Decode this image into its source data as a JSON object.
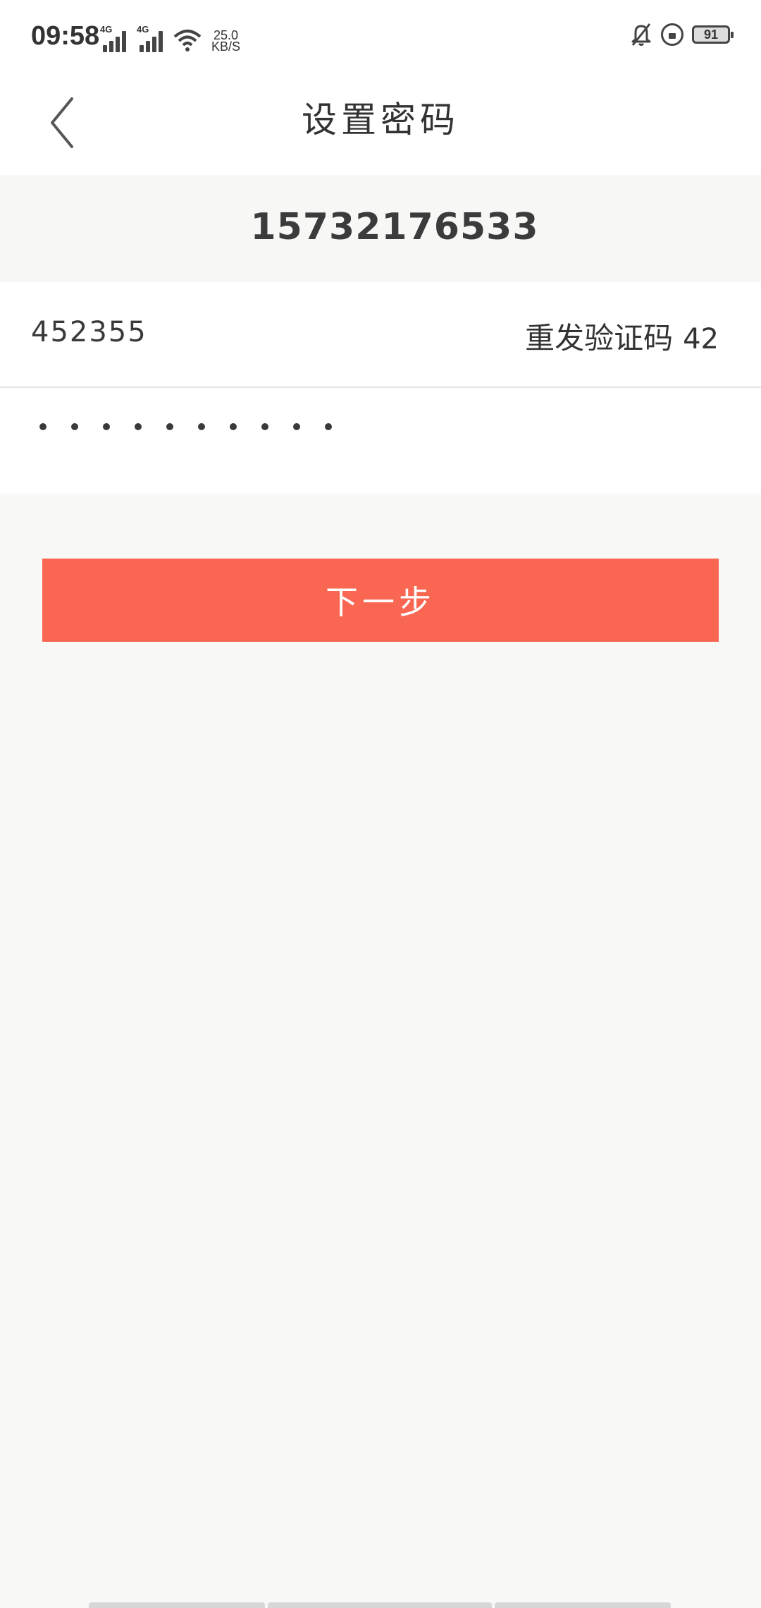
{
  "status_bar": {
    "time": "09:58",
    "network_1": "4G",
    "network_2": "4G",
    "speed_value": "25.0",
    "speed_unit": "KB/S",
    "battery": "91",
    "icons": [
      "signal-icon",
      "signal-icon",
      "wifi-icon",
      "mute-bell-icon",
      "rotation-lock-icon",
      "battery-icon"
    ]
  },
  "header": {
    "title": "设置密码",
    "back_icon": "back-chevron-icon"
  },
  "form": {
    "phone": "15732176533",
    "code_value": "452355",
    "resend_label": "重发验证码",
    "resend_countdown": "42",
    "password_masked_length": 10
  },
  "actions": {
    "next_label": "下一步"
  },
  "colors": {
    "accent": "#f96752",
    "background": "#f8f8f6",
    "surface": "#ffffff",
    "text": "#333333"
  }
}
